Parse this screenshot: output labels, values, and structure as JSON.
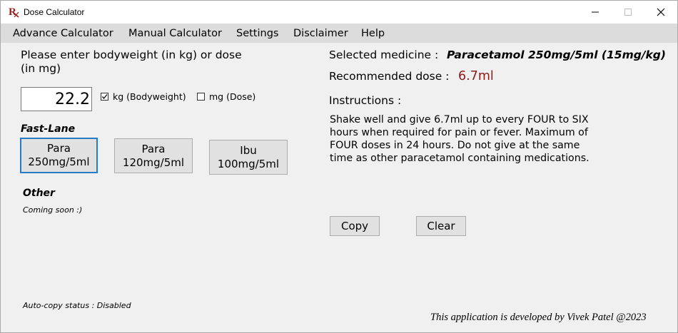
{
  "window": {
    "title": "Dose Calculator",
    "logo": "R-logo",
    "controls": [
      "minimize-icon",
      "maximize-icon",
      "close-icon"
    ]
  },
  "menu": {
    "items": [
      "Advance Calculator",
      "Manual Calculator",
      "Settings",
      "Disclaimer",
      "Help"
    ]
  },
  "input": {
    "prompt": "Please enter bodyweight (in kg) or dose (in mg)",
    "value": "22.2",
    "kg_label": "kg (Bodyweight)",
    "kg_checked": true,
    "mg_label": "mg (Dose)",
    "mg_checked": false
  },
  "fast_lane": {
    "heading": "Fast-Lane",
    "buttons": [
      {
        "line1": "Para",
        "line2": "250mg/5ml",
        "active": true
      },
      {
        "line1": "Para",
        "line2": "120mg/5ml",
        "active": false
      },
      {
        "line1": "Ibu",
        "line2": "100mg/5ml",
        "active": false
      }
    ]
  },
  "other": {
    "heading": "Other",
    "note": "Coming soon :)"
  },
  "result": {
    "selected_label": "Selected medicine :",
    "selected_value": "Paracetamol 250mg/5ml (15mg/kg)",
    "dose_label": "Recommended dose :",
    "dose_value": "6.7ml",
    "dose_color": "#8b1a1a",
    "instructions_label": "Instructions :",
    "instructions_text": "Shake well and give 6.7ml up to every FOUR to SIX hours when required for pain or fever. Maximum of FOUR doses in 24 hours. Do not give at the same time as other paracetamol containing medications."
  },
  "actions": {
    "copy_label": "Copy",
    "clear_label": "Clear"
  },
  "status": {
    "autocopy": "Auto-copy status : Disabled",
    "credit": "This application is developed by Vivek Patel @2023"
  },
  "colors": {
    "menubar": "#dcdcdc",
    "background": "#f0f0f0",
    "active_border": "#2a7bc6"
  }
}
